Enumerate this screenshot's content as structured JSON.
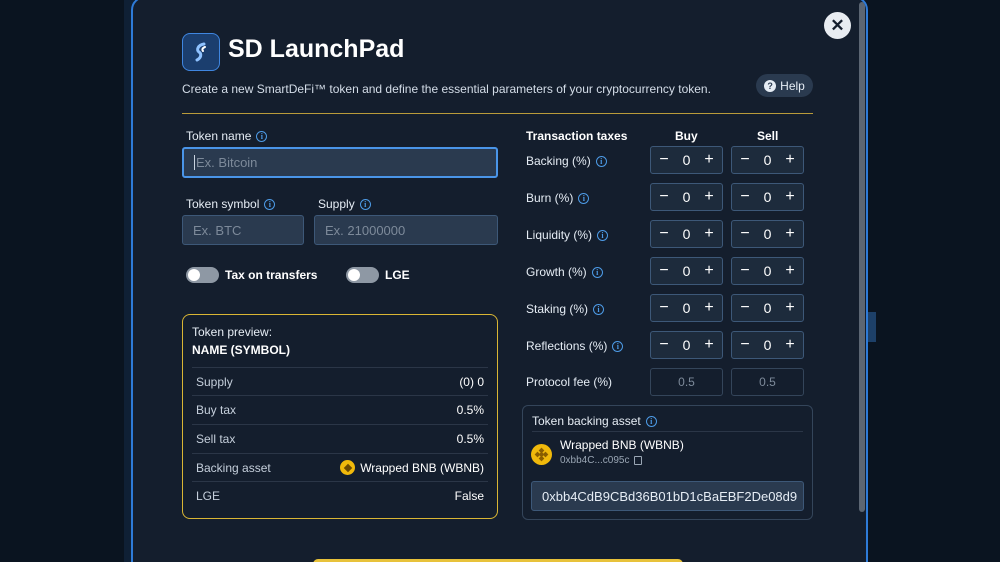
{
  "app": {
    "title": "SD LaunchPad",
    "subtitle": "Create a new SmartDeFi™ token and define the essential parameters of your cryptocurrency token.",
    "help_label": "Help",
    "close_symbol": "✕"
  },
  "form": {
    "token_name": {
      "label": "Token name",
      "placeholder": "Ex. Bitcoin",
      "value": ""
    },
    "token_symbol": {
      "label": "Token symbol",
      "placeholder": "Ex. BTC",
      "value": ""
    },
    "supply": {
      "label": "Supply",
      "placeholder": "Ex. 21000000",
      "value": ""
    },
    "toggles": [
      {
        "label": "Tax on transfers",
        "on": false
      },
      {
        "label": "LGE",
        "on": false
      }
    ]
  },
  "preview": {
    "title": "Token preview:",
    "name": "NAME (SYMBOL)",
    "rows": [
      {
        "key": "Supply",
        "value": "(0) 0"
      },
      {
        "key": "Buy tax",
        "value": "0.5%"
      },
      {
        "key": "Sell tax",
        "value": "0.5%"
      },
      {
        "key": "Backing asset",
        "value": "Wrapped BNB (WBNB)"
      },
      {
        "key": "LGE",
        "value": "False"
      }
    ]
  },
  "taxes": {
    "header": "Transaction taxes",
    "buy_header": "Buy",
    "sell_header": "Sell",
    "rows": [
      {
        "label": "Backing (%)",
        "buy": "0",
        "sell": "0"
      },
      {
        "label": "Burn (%)",
        "buy": "0",
        "sell": "0"
      },
      {
        "label": "Liquidity (%)",
        "buy": "0",
        "sell": "0"
      },
      {
        "label": "Growth (%)",
        "buy": "0",
        "sell": "0"
      },
      {
        "label": "Staking (%)",
        "buy": "0",
        "sell": "0"
      },
      {
        "label": "Reflections (%)",
        "buy": "0",
        "sell": "0"
      }
    ],
    "protocol_fee": {
      "label": "Protocol fee (%)",
      "buy": "0.5",
      "sell": "0.5"
    },
    "minus": "−",
    "plus": "+"
  },
  "backing_asset": {
    "title": "Token backing asset",
    "name": "Wrapped BNB (WBNB)",
    "short_address": "0xbb4C...c095c",
    "address_value": "0xbb4CdB9CBd36B01bD1cBaEBF2De08d9"
  },
  "colors": {
    "accent": "#2e7bd8",
    "gold": "#d9b634",
    "bnb": "#f0b90b"
  }
}
